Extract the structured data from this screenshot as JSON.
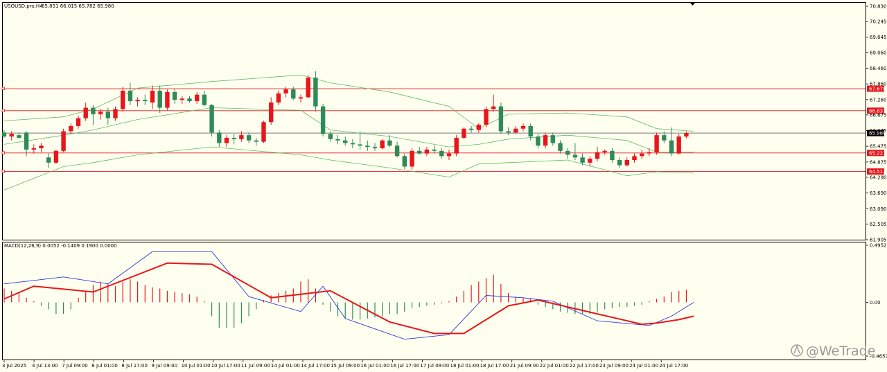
{
  "window": {
    "title": "USOUSD.pro,H4",
    "ohlc": "65.851 66.015 65.782 65.980"
  },
  "indicator": {
    "label": "MACD(12,26,9) 0.0052 -0.1409 0.1900 0.0000"
  },
  "watermark": "@WeTrade",
  "icons": {
    "watermark_logo": "wetrade-logo-icon",
    "scroll_marker": "triangle-down-icon"
  },
  "colors": {
    "background": "#fffff0",
    "bull": "#2e8b57",
    "bear": "#e8161b",
    "bands": "#5dbb63",
    "level": "#e8161b",
    "macd_main": "#2a37d6",
    "macd_signal": "#e8161b"
  },
  "price_axis": [
    "70.830",
    "70.245",
    "69.645",
    "69.060",
    "68.460",
    "67.860",
    "67.260",
    "66.675",
    "66.075",
    "65.475",
    "64.875",
    "64.290",
    "63.690",
    "63.090",
    "62.505",
    "61.905"
  ],
  "price_levels": [
    {
      "label": "67.678",
      "value": 67.678
    },
    {
      "label": "66.837",
      "value": 66.837
    },
    {
      "label": "65.221",
      "value": 65.221
    },
    {
      "label": "64.512",
      "value": 64.512
    }
  ],
  "current_price": {
    "label": "65.980",
    "value": 65.98
  },
  "macd_axis": [
    "0.4952",
    "0.00",
    "-0.4657"
  ],
  "time_axis": [
    "3 Jul 2025",
    "4 Jul 13:00",
    "7 Jul 09:00",
    "8 Jul 01:00",
    "8 Jul 17:00",
    "9 Jul 09:00",
    "10 Jul 01:00",
    "10 Jul 17:00",
    "11 Jul 09:00",
    "14 Jul 01:00",
    "14 Jul 17:00",
    "15 Jul 09:00",
    "16 Jul 01:00",
    "16 Jul 17:00",
    "17 Jul 09:00",
    "18 Jul 01:00",
    "18 Jul 17:00",
    "21 Jul 09:00",
    "22 Jul 01:00",
    "22 Jul 17:00",
    "23 Jul 09:00",
    "24 Jul 01:00",
    "24 Jul 17:00"
  ],
  "chart_data": {
    "type": "candlestick",
    "symbol": "USOUSD.pro",
    "timeframe": "H4",
    "ylim": [
      61.905,
      70.83
    ],
    "candles": [
      {
        "o": 66.0,
        "h": 66.1,
        "l": 65.8,
        "c": 65.85
      },
      {
        "o": 65.85,
        "h": 66.05,
        "l": 65.7,
        "c": 65.95
      },
      {
        "o": 65.9,
        "h": 66.0,
        "l": 65.75,
        "c": 65.8
      },
      {
        "o": 66.0,
        "h": 66.05,
        "l": 65.1,
        "c": 65.35
      },
      {
        "o": 65.35,
        "h": 65.55,
        "l": 65.2,
        "c": 65.4
      },
      {
        "o": 65.4,
        "h": 65.6,
        "l": 65.25,
        "c": 65.5
      },
      {
        "o": 65.05,
        "h": 65.2,
        "l": 64.65,
        "c": 64.85
      },
      {
        "o": 64.85,
        "h": 65.35,
        "l": 64.8,
        "c": 65.3
      },
      {
        "o": 65.3,
        "h": 66.15,
        "l": 65.25,
        "c": 66.05
      },
      {
        "o": 66.05,
        "h": 66.35,
        "l": 65.95,
        "c": 66.25
      },
      {
        "o": 66.25,
        "h": 66.65,
        "l": 66.15,
        "c": 66.55
      },
      {
        "o": 66.55,
        "h": 67.15,
        "l": 66.45,
        "c": 66.95
      },
      {
        "o": 66.95,
        "h": 67.05,
        "l": 66.3,
        "c": 66.7
      },
      {
        "o": 66.7,
        "h": 66.9,
        "l": 66.5,
        "c": 66.8
      },
      {
        "o": 66.8,
        "h": 66.95,
        "l": 66.3,
        "c": 66.55
      },
      {
        "o": 66.55,
        "h": 67.0,
        "l": 66.45,
        "c": 66.9
      },
      {
        "o": 66.9,
        "h": 67.75,
        "l": 66.8,
        "c": 67.6
      },
      {
        "o": 67.6,
        "h": 67.9,
        "l": 67.05,
        "c": 67.2
      },
      {
        "o": 67.2,
        "h": 67.35,
        "l": 67.0,
        "c": 67.25
      },
      {
        "o": 67.25,
        "h": 67.45,
        "l": 67.05,
        "c": 67.2
      },
      {
        "o": 67.15,
        "h": 67.8,
        "l": 66.9,
        "c": 67.6
      },
      {
        "o": 67.6,
        "h": 67.8,
        "l": 66.75,
        "c": 66.95
      },
      {
        "o": 66.95,
        "h": 67.65,
        "l": 66.85,
        "c": 67.55
      },
      {
        "o": 67.55,
        "h": 67.65,
        "l": 67.1,
        "c": 67.25
      },
      {
        "o": 67.25,
        "h": 67.4,
        "l": 67.1,
        "c": 67.3
      },
      {
        "o": 67.3,
        "h": 67.4,
        "l": 67.15,
        "c": 67.2
      },
      {
        "o": 67.2,
        "h": 67.55,
        "l": 67.1,
        "c": 67.45
      },
      {
        "o": 67.45,
        "h": 67.6,
        "l": 67.0,
        "c": 67.05
      },
      {
        "o": 67.05,
        "h": 67.1,
        "l": 65.85,
        "c": 66.0
      },
      {
        "o": 66.0,
        "h": 66.1,
        "l": 65.45,
        "c": 65.6
      },
      {
        "o": 65.6,
        "h": 65.9,
        "l": 65.45,
        "c": 65.8
      },
      {
        "o": 65.8,
        "h": 65.95,
        "l": 65.55,
        "c": 65.75
      },
      {
        "o": 65.75,
        "h": 66.05,
        "l": 65.65,
        "c": 65.9
      },
      {
        "o": 65.9,
        "h": 66.0,
        "l": 65.6,
        "c": 65.7
      },
      {
        "o": 65.7,
        "h": 65.8,
        "l": 65.5,
        "c": 65.65
      },
      {
        "o": 65.65,
        "h": 66.45,
        "l": 65.6,
        "c": 66.4
      },
      {
        "o": 66.4,
        "h": 67.35,
        "l": 66.3,
        "c": 67.15
      },
      {
        "o": 67.15,
        "h": 67.6,
        "l": 67.05,
        "c": 67.5
      },
      {
        "o": 67.5,
        "h": 67.75,
        "l": 67.35,
        "c": 67.65
      },
      {
        "o": 67.65,
        "h": 67.75,
        "l": 67.25,
        "c": 67.3
      },
      {
        "o": 67.3,
        "h": 67.45,
        "l": 67.15,
        "c": 67.35
      },
      {
        "o": 67.35,
        "h": 68.2,
        "l": 67.3,
        "c": 68.1
      },
      {
        "o": 68.1,
        "h": 68.35,
        "l": 66.8,
        "c": 67.0
      },
      {
        "o": 67.0,
        "h": 67.1,
        "l": 65.85,
        "c": 65.95
      },
      {
        "o": 65.95,
        "h": 66.05,
        "l": 65.65,
        "c": 65.75
      },
      {
        "o": 65.75,
        "h": 65.9,
        "l": 65.55,
        "c": 65.7
      },
      {
        "o": 65.7,
        "h": 65.85,
        "l": 65.5,
        "c": 65.6
      },
      {
        "o": 65.6,
        "h": 65.75,
        "l": 65.4,
        "c": 65.55
      },
      {
        "o": 65.55,
        "h": 66.05,
        "l": 65.35,
        "c": 65.5
      },
      {
        "o": 65.5,
        "h": 65.7,
        "l": 65.3,
        "c": 65.45
      },
      {
        "o": 65.45,
        "h": 65.6,
        "l": 65.3,
        "c": 65.4
      },
      {
        "o": 65.4,
        "h": 65.75,
        "l": 65.35,
        "c": 65.7
      },
      {
        "o": 65.7,
        "h": 65.9,
        "l": 65.45,
        "c": 65.5
      },
      {
        "o": 65.5,
        "h": 65.65,
        "l": 65.05,
        "c": 65.1
      },
      {
        "o": 65.1,
        "h": 65.2,
        "l": 64.6,
        "c": 64.7
      },
      {
        "o": 64.7,
        "h": 65.4,
        "l": 64.55,
        "c": 65.3
      },
      {
        "o": 65.3,
        "h": 65.45,
        "l": 65.15,
        "c": 65.2
      },
      {
        "o": 65.2,
        "h": 65.45,
        "l": 65.1,
        "c": 65.35
      },
      {
        "o": 65.35,
        "h": 65.5,
        "l": 65.2,
        "c": 65.3
      },
      {
        "o": 65.3,
        "h": 65.4,
        "l": 65.0,
        "c": 65.1
      },
      {
        "o": 65.1,
        "h": 65.35,
        "l": 64.95,
        "c": 65.2
      },
      {
        "o": 65.2,
        "h": 65.9,
        "l": 65.1,
        "c": 65.8
      },
      {
        "o": 65.8,
        "h": 66.2,
        "l": 65.75,
        "c": 66.15
      },
      {
        "o": 66.15,
        "h": 66.25,
        "l": 66.0,
        "c": 66.1
      },
      {
        "o": 66.1,
        "h": 66.35,
        "l": 66.0,
        "c": 66.3
      },
      {
        "o": 66.3,
        "h": 67.0,
        "l": 66.2,
        "c": 66.9
      },
      {
        "o": 66.9,
        "h": 67.45,
        "l": 66.8,
        "c": 67.0
      },
      {
        "o": 67.0,
        "h": 67.15,
        "l": 65.95,
        "c": 66.05
      },
      {
        "o": 66.05,
        "h": 66.2,
        "l": 65.9,
        "c": 66.0
      },
      {
        "o": 66.0,
        "h": 66.25,
        "l": 65.95,
        "c": 66.15
      },
      {
        "o": 66.15,
        "h": 66.35,
        "l": 66.05,
        "c": 66.25
      },
      {
        "o": 66.25,
        "h": 66.35,
        "l": 65.7,
        "c": 65.85
      },
      {
        "o": 65.85,
        "h": 65.95,
        "l": 65.4,
        "c": 65.5
      },
      {
        "o": 65.5,
        "h": 66.0,
        "l": 65.4,
        "c": 65.9
      },
      {
        "o": 65.9,
        "h": 66.0,
        "l": 65.5,
        "c": 65.6
      },
      {
        "o": 65.6,
        "h": 65.7,
        "l": 65.2,
        "c": 65.3
      },
      {
        "o": 65.3,
        "h": 65.4,
        "l": 65.0,
        "c": 65.15
      },
      {
        "o": 65.15,
        "h": 65.6,
        "l": 64.95,
        "c": 65.05
      },
      {
        "o": 65.05,
        "h": 65.2,
        "l": 64.75,
        "c": 64.85
      },
      {
        "o": 64.85,
        "h": 65.1,
        "l": 64.7,
        "c": 65.0
      },
      {
        "o": 65.0,
        "h": 65.45,
        "l": 64.9,
        "c": 65.25
      },
      {
        "o": 65.25,
        "h": 65.35,
        "l": 65.15,
        "c": 65.3
      },
      {
        "o": 65.3,
        "h": 65.4,
        "l": 64.85,
        "c": 64.95
      },
      {
        "o": 64.95,
        "h": 65.05,
        "l": 64.65,
        "c": 64.75
      },
      {
        "o": 64.75,
        "h": 65.05,
        "l": 64.7,
        "c": 64.95
      },
      {
        "o": 64.95,
        "h": 65.2,
        "l": 64.85,
        "c": 65.1
      },
      {
        "o": 65.1,
        "h": 65.35,
        "l": 65.0,
        "c": 65.2
      },
      {
        "o": 65.2,
        "h": 65.4,
        "l": 65.1,
        "c": 65.25
      },
      {
        "o": 65.25,
        "h": 66.0,
        "l": 65.15,
        "c": 65.9
      },
      {
        "o": 65.9,
        "h": 66.05,
        "l": 65.6,
        "c": 65.7
      },
      {
        "o": 65.7,
        "h": 66.2,
        "l": 65.1,
        "c": 65.2
      },
      {
        "o": 65.2,
        "h": 65.95,
        "l": 65.15,
        "c": 65.85
      },
      {
        "o": 65.85,
        "h": 66.05,
        "l": 65.78,
        "c": 65.98
      }
    ],
    "bollinger": {
      "upper": [
        [
          0,
          66.45
        ],
        [
          8,
          66.6
        ],
        [
          12,
          66.9
        ],
        [
          18,
          67.7
        ],
        [
          28,
          67.95
        ],
        [
          40,
          68.2
        ],
        [
          44,
          67.9
        ],
        [
          52,
          67.55
        ],
        [
          60,
          67.0
        ],
        [
          64,
          66.15
        ],
        [
          68,
          66.7
        ],
        [
          76,
          66.75
        ],
        [
          84,
          66.6
        ],
        [
          88,
          66.15
        ],
        [
          93,
          66.05
        ]
      ],
      "middle": [
        [
          0,
          65.55
        ],
        [
          8,
          65.9
        ],
        [
          12,
          66.1
        ],
        [
          18,
          66.5
        ],
        [
          28,
          66.95
        ],
        [
          40,
          66.85
        ],
        [
          44,
          66.1
        ],
        [
          52,
          65.85
        ],
        [
          60,
          65.45
        ],
        [
          64,
          65.55
        ],
        [
          68,
          65.75
        ],
        [
          76,
          65.9
        ],
        [
          84,
          65.7
        ],
        [
          88,
          65.25
        ],
        [
          93,
          65.25
        ]
      ],
      "lower": [
        [
          0,
          63.8
        ],
        [
          8,
          64.7
        ],
        [
          12,
          64.85
        ],
        [
          18,
          65.15
        ],
        [
          28,
          65.45
        ],
        [
          40,
          65.15
        ],
        [
          44,
          64.95
        ],
        [
          52,
          64.65
        ],
        [
          60,
          64.3
        ],
        [
          64,
          64.8
        ],
        [
          68,
          64.85
        ],
        [
          76,
          64.95
        ],
        [
          84,
          64.35
        ],
        [
          88,
          64.5
        ],
        [
          93,
          64.45
        ]
      ]
    },
    "macd": {
      "histogram": [
        0.12,
        0.1,
        0.08,
        0.04,
        0.01,
        -0.03,
        -0.06,
        -0.1,
        -0.1,
        -0.06,
        0.04,
        0.1,
        0.15,
        0.18,
        0.16,
        0.14,
        0.18,
        0.2,
        0.18,
        0.15,
        0.13,
        0.12,
        0.1,
        0.09,
        0.08,
        0.07,
        0.05,
        0.01,
        -0.12,
        -0.22,
        -0.22,
        -0.22,
        -0.18,
        -0.12,
        -0.06,
        0.02,
        0.06,
        0.08,
        0.1,
        0.12,
        0.18,
        0.2,
        0.12,
        -0.02,
        -0.08,
        -0.12,
        -0.14,
        -0.15,
        -0.15,
        -0.14,
        -0.13,
        -0.12,
        -0.1,
        -0.1,
        -0.08,
        -0.05,
        -0.04,
        -0.03,
        -0.02,
        -0.01,
        0.01,
        0.05,
        0.1,
        0.15,
        0.18,
        0.21,
        0.24,
        0.16,
        0.08,
        0.05,
        0.04,
        0.03,
        -0.02,
        -0.04,
        -0.06,
        -0.08,
        -0.09,
        -0.1,
        -0.1,
        -0.1,
        -0.08,
        -0.06,
        -0.05,
        -0.04,
        -0.04,
        -0.03,
        -0.02,
        0.01,
        0.03,
        0.05,
        0.09,
        0.1,
        0.11
      ],
      "main_line": [
        [
          0,
          0.16
        ],
        [
          8,
          0.22
        ],
        [
          14,
          0.16
        ],
        [
          20,
          0.44
        ],
        [
          28,
          0.44
        ],
        [
          33,
          0.05
        ],
        [
          40,
          -0.08
        ],
        [
          43,
          0.14
        ],
        [
          46,
          -0.14
        ],
        [
          54,
          -0.32
        ],
        [
          60,
          -0.28
        ],
        [
          65,
          0.06
        ],
        [
          70,
          0.04
        ],
        [
          74,
          0.01
        ],
        [
          80,
          -0.16
        ],
        [
          87,
          -0.2
        ],
        [
          90,
          -0.12
        ],
        [
          93,
          0.0
        ]
      ],
      "signal_line": [
        [
          0,
          0.03
        ],
        [
          4,
          0.14
        ],
        [
          12,
          0.09
        ],
        [
          22,
          0.34
        ],
        [
          28,
          0.33
        ],
        [
          36,
          0.04
        ],
        [
          44,
          0.1
        ],
        [
          52,
          -0.17
        ],
        [
          58,
          -0.27
        ],
        [
          62,
          -0.27
        ],
        [
          68,
          -0.03
        ],
        [
          72,
          0.02
        ],
        [
          80,
          -0.1
        ],
        [
          86,
          -0.19
        ],
        [
          88,
          -0.18
        ],
        [
          91,
          -0.15
        ],
        [
          93,
          -0.12
        ]
      ]
    }
  }
}
